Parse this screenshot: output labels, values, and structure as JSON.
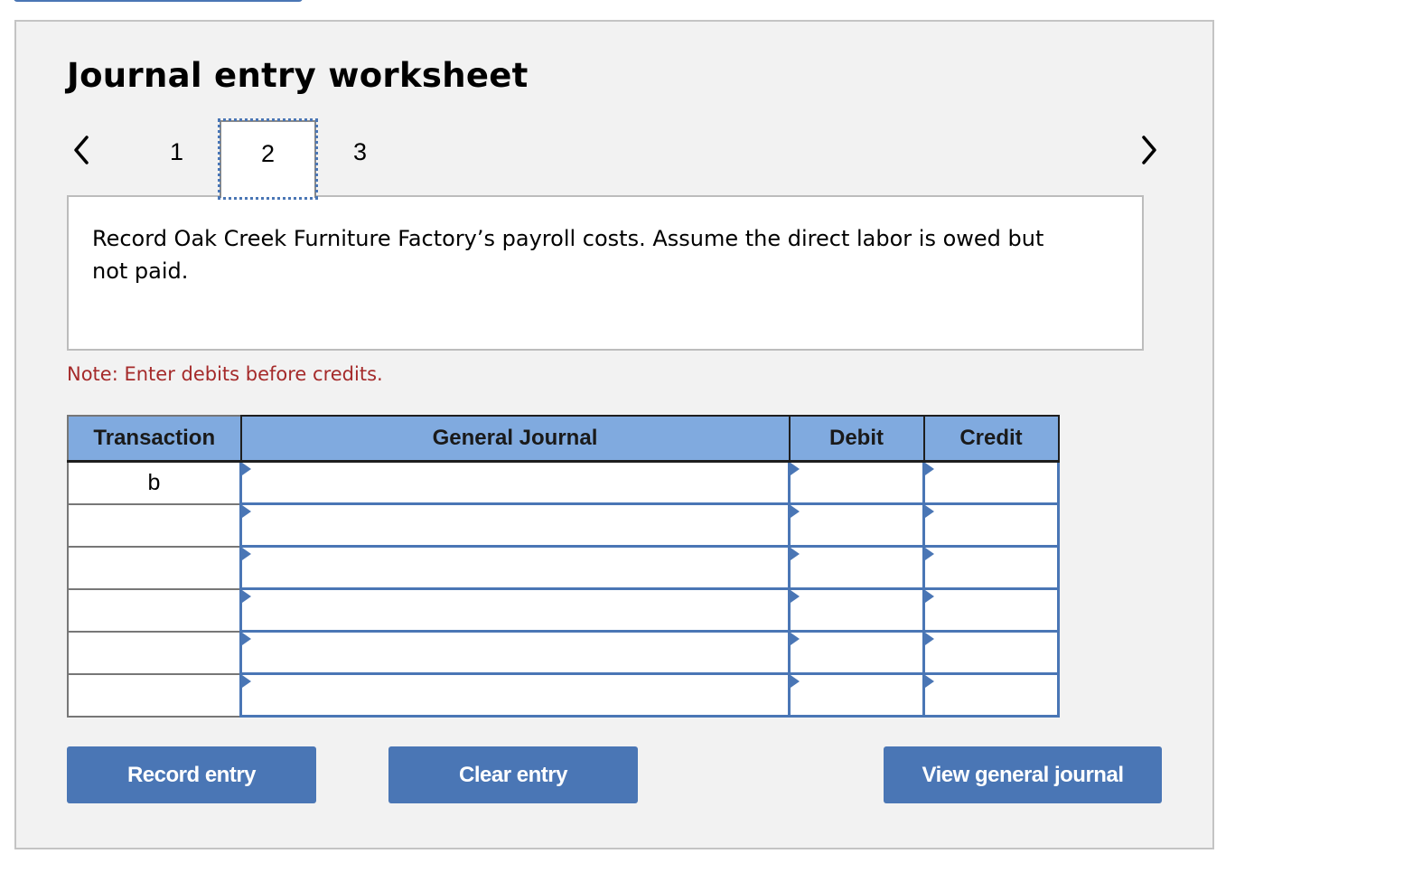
{
  "header": {
    "title": "Journal entry worksheet"
  },
  "pager": {
    "prev_icon": "chevron-left-icon",
    "next_icon": "chevron-right-icon",
    "tabs": [
      {
        "label": "1",
        "active": false
      },
      {
        "label": "2",
        "active": true
      },
      {
        "label": "3",
        "active": false
      }
    ]
  },
  "prompt": {
    "text": "Record Oak Creek Furniture Factory’s payroll costs. Assume the direct labor is owed but not paid."
  },
  "note": "Note: Enter debits before credits.",
  "table": {
    "columns": [
      "Transaction",
      "General Journal",
      "Debit",
      "Credit"
    ],
    "rows": [
      {
        "transaction": "b",
        "account": "",
        "debit": "",
        "credit": ""
      },
      {
        "transaction": "",
        "account": "",
        "debit": "",
        "credit": ""
      },
      {
        "transaction": "",
        "account": "",
        "debit": "",
        "credit": ""
      },
      {
        "transaction": "",
        "account": "",
        "debit": "",
        "credit": ""
      },
      {
        "transaction": "",
        "account": "",
        "debit": "",
        "credit": ""
      },
      {
        "transaction": "",
        "account": "",
        "debit": "",
        "credit": ""
      }
    ]
  },
  "buttons": {
    "record": "Record entry",
    "clear": "Clear entry",
    "view": "View general journal"
  },
  "colors": {
    "accent": "#4a76b5",
    "header_bg": "#80aadf",
    "note": "#a52a2a",
    "panel_bg": "#f2f2f2"
  }
}
